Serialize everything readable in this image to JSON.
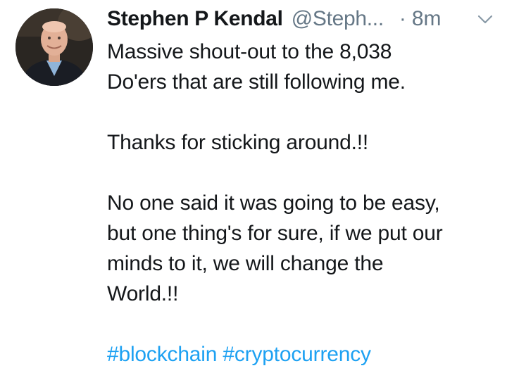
{
  "tweet": {
    "author_name": "Stephen P Kendal",
    "author_handle": "@Steph...",
    "separator": "·",
    "timestamp": "8m",
    "paragraphs": [
      "Massive shout-out to the 8,038\nDo'ers that are still following me.",
      "Thanks for sticking around.!!",
      "No one said it was going to be easy,\nbut one thing's for sure, if we put our\nminds to it, we will change the\nWorld.!!"
    ],
    "hashtags": [
      "#blockchain",
      "#cryptocurrency"
    ],
    "menu_icon": "chevron-down-icon",
    "avatar_icon": "profile-photo"
  },
  "colors": {
    "text": "#14171a",
    "secondary": "#657786",
    "link": "#1da1f2",
    "background": "#ffffff"
  }
}
